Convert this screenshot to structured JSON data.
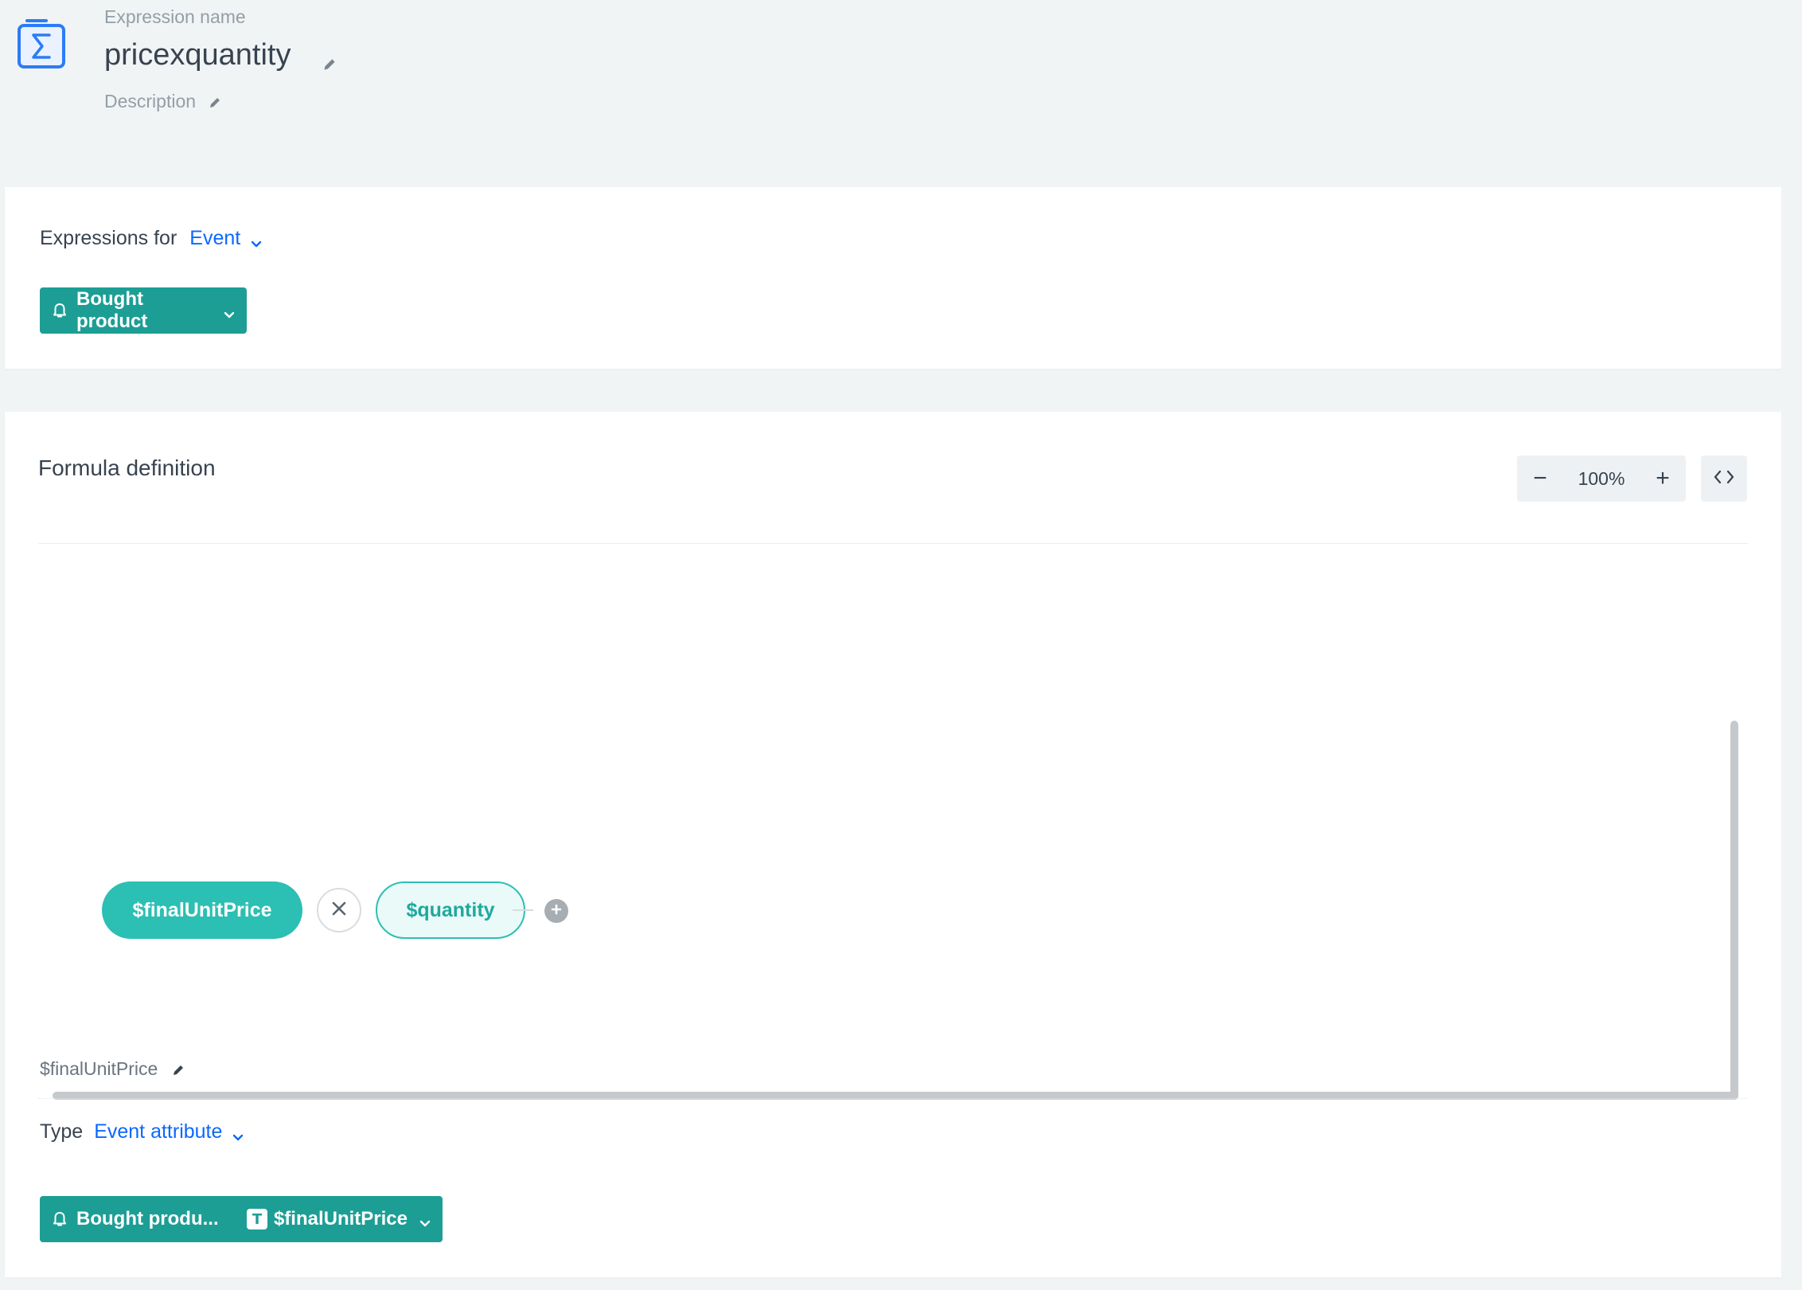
{
  "header": {
    "expression_name_label": "Expression name",
    "expression_name": "pricexquantity",
    "description_label": "Description",
    "icon": "sigma-icon"
  },
  "expressions_for": {
    "label": "Expressions for",
    "selected": "Event",
    "event_selector": "Bought product"
  },
  "formula": {
    "title": "Formula definition",
    "zoom": {
      "minus": "−",
      "value": "100%",
      "plus": "+"
    },
    "nodes": {
      "left": "$finalUnitPrice",
      "operator": "×",
      "right": "$quantity"
    }
  },
  "selected_node": {
    "name": "$finalUnitPrice",
    "type_label": "Type",
    "type_value": "Event attribute",
    "event_short": "Bought produ...",
    "attribute": "$finalUnitPrice",
    "attribute_type_glyph": "T"
  },
  "colors": {
    "accent_blue": "#0b68ff",
    "teal_dark": "#1d9e95",
    "teal": "#2cbfb3"
  }
}
